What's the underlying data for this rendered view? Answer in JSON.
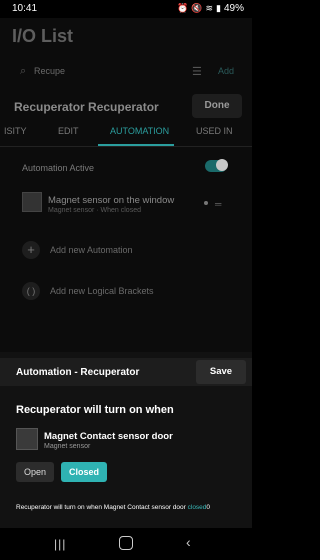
{
  "status": {
    "time": "10:41",
    "battery": "49%",
    "icons": [
      "alarm-icon",
      "mute-icon",
      "wifi-icon",
      "signal-icon"
    ]
  },
  "app": {
    "title": "I/O List",
    "search_value": "Recupe",
    "add_link": "Add",
    "device_title": "Recuperator Recuperator",
    "done_label": "Done",
    "tabs": [
      "ISITY",
      "EDIT",
      "AUTOMATION",
      "USED IN"
    ],
    "active_tab": "AUTOMATION",
    "automation_active_label": "Automation Active",
    "automation_active": true,
    "rule": {
      "title": "Magnet sensor on the window",
      "subtitle": "Magnet sensor · When closed"
    },
    "add_automation": "Add new Automation",
    "add_brackets": "Add new Logical Brackets"
  },
  "sheet": {
    "title": "Automation - Recuperator",
    "save_label": "Save",
    "heading": "Recuperator will turn on when",
    "sensor_name": "Magnet Contact sensor door",
    "sensor_type": "Magnet sensor",
    "open_label": "Open",
    "closed_label": "Closed",
    "selected": "Closed",
    "summary_prefix": "Recuperator will turn on when Magnet Contact sensor door ",
    "summary_state": "closed",
    "summary_suffix": "0",
    "accent": "#2fb3b3"
  },
  "navbar": {
    "icons": [
      "recent-apps-icon",
      "home-icon",
      "back-icon"
    ]
  }
}
